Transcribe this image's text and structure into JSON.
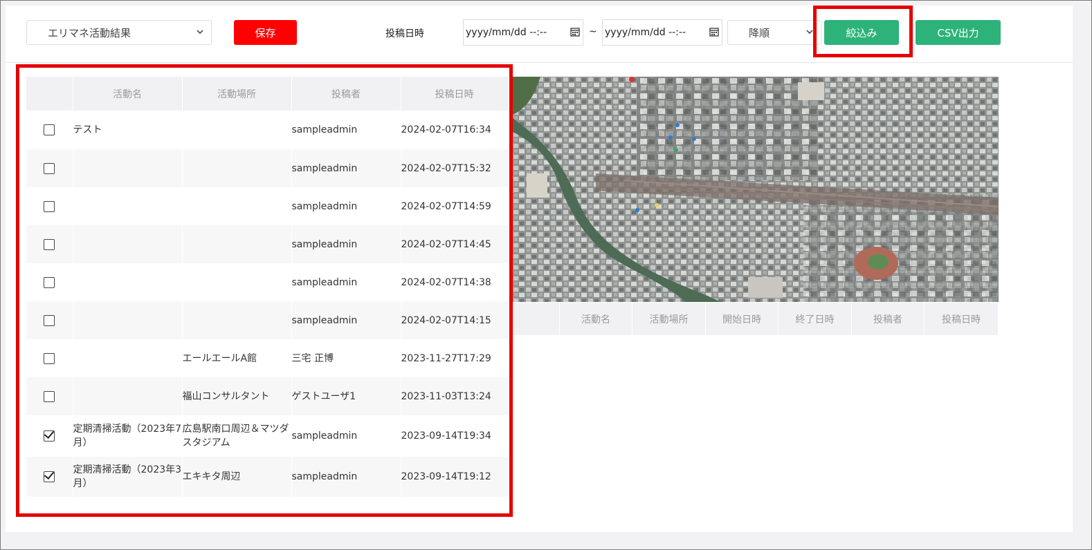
{
  "toolbar": {
    "category_select": "エリマネ活動結果",
    "save_label": "保存",
    "date_label": "投稿日時",
    "date_from_placeholder": "yyyy/mm/dd --:--",
    "date_separator": "~",
    "date_to_placeholder": "yyyy/mm/dd --:--",
    "order_select": "降順",
    "filter_label": "絞込み",
    "csv_label": "CSV出力"
  },
  "results_table": {
    "columns": [
      "",
      "活動名",
      "活動場所",
      "投稿者",
      "投稿日時"
    ],
    "rows": [
      {
        "checked": false,
        "name_line1": "テスト",
        "name_line2": "",
        "place_line1": "",
        "place_line2": "",
        "poster": "sampleadmin",
        "posted": "2024-02-07T16:34"
      },
      {
        "checked": false,
        "name_line1": "",
        "name_line2": "",
        "place_line1": "",
        "place_line2": "",
        "poster": "sampleadmin",
        "posted": "2024-02-07T15:32"
      },
      {
        "checked": false,
        "name_line1": "",
        "name_line2": "",
        "place_line1": "",
        "place_line2": "",
        "poster": "sampleadmin",
        "posted": "2024-02-07T14:59"
      },
      {
        "checked": false,
        "name_line1": "",
        "name_line2": "",
        "place_line1": "",
        "place_line2": "",
        "poster": "sampleadmin",
        "posted": "2024-02-07T14:45"
      },
      {
        "checked": false,
        "name_line1": "",
        "name_line2": "",
        "place_line1": "",
        "place_line2": "",
        "poster": "sampleadmin",
        "posted": "2024-02-07T14:38"
      },
      {
        "checked": false,
        "name_line1": "",
        "name_line2": "",
        "place_line1": "",
        "place_line2": "",
        "poster": "sampleadmin",
        "posted": "2024-02-07T14:15"
      },
      {
        "checked": false,
        "name_line1": "",
        "name_line2": "",
        "place_line1": "エールエールA館",
        "place_line2": "",
        "poster": "三宅 正博",
        "posted": "2023-11-27T17:29"
      },
      {
        "checked": false,
        "name_line1": "",
        "name_line2": "",
        "place_line1": "福山コンサルタント",
        "place_line2": "",
        "poster": "ゲストユーザ1",
        "posted": "2023-11-03T13:24"
      },
      {
        "checked": true,
        "name_line1": "定期清掃活動（2023年7",
        "name_line2": "月）",
        "place_line1": "広島駅南口周辺＆マツダ",
        "place_line2": "スタジアム",
        "poster": "sampleadmin",
        "posted": "2023-09-14T19:34"
      },
      {
        "checked": true,
        "name_line1": "定期清掃活動（2023年3",
        "name_line2": "月）",
        "place_line1": "エキキタ周辺",
        "place_line2": "",
        "poster": "sampleadmin",
        "posted": "2023-09-14T19:12"
      }
    ]
  },
  "detail_table": {
    "columns": [
      "活動名",
      "活動場所",
      "開始日時",
      "終了日時",
      "投稿者",
      "投稿日時"
    ]
  },
  "colors": {
    "highlight": "#e60000",
    "save_button": "#ff0000",
    "action_button": "#2db37a"
  }
}
